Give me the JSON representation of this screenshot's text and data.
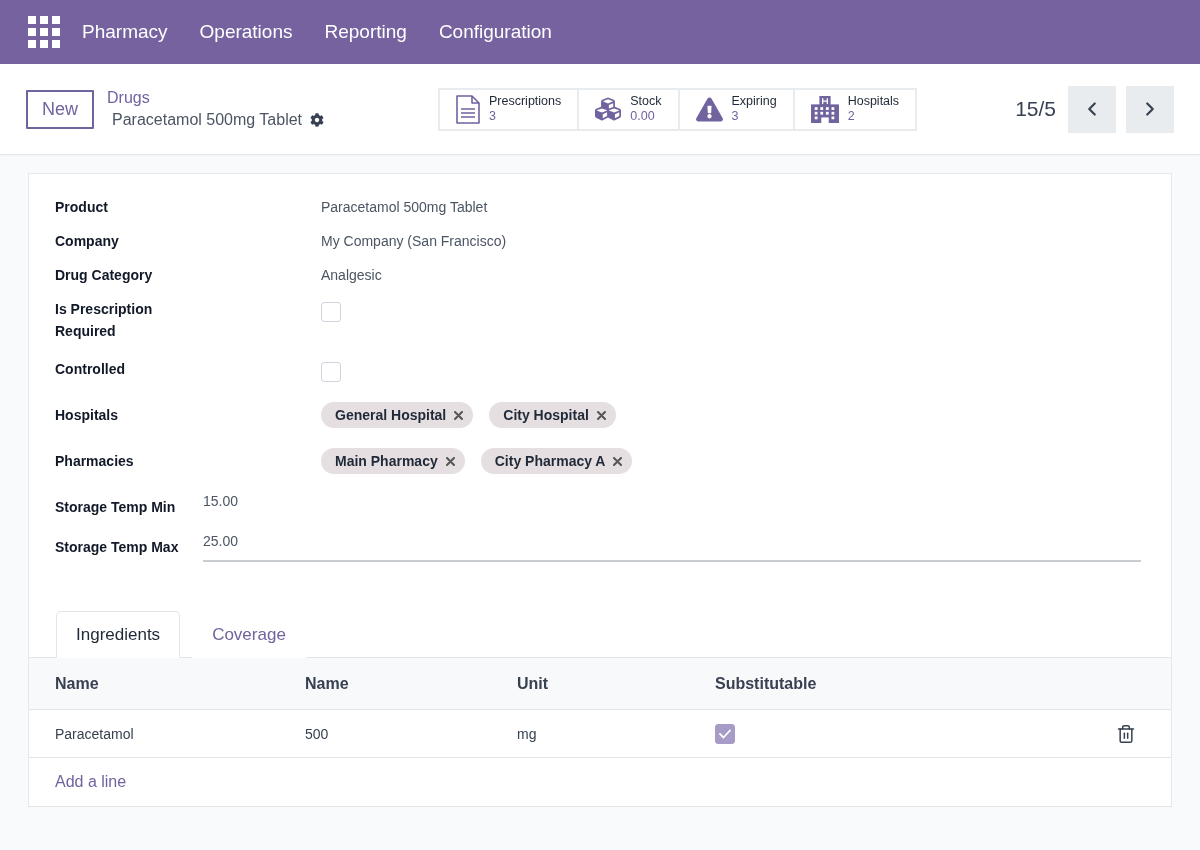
{
  "navbar": {
    "menu": [
      {
        "label": "Pharmacy"
      },
      {
        "label": "Operations"
      },
      {
        "label": "Reporting"
      },
      {
        "label": "Configuration"
      }
    ]
  },
  "control_panel": {
    "new_button": "New",
    "breadcrumb": {
      "parent": "Drugs",
      "current": "Paracetamol 500mg Tablet"
    },
    "smart_buttons": [
      {
        "kind": "document",
        "label": "Prescriptions",
        "value": "3"
      },
      {
        "kind": "cubes",
        "label": "Stock",
        "value": "0.00"
      },
      {
        "kind": "warning",
        "label": "Expiring",
        "value": "3"
      },
      {
        "kind": "building",
        "label": "Hospitals",
        "value": "2"
      }
    ],
    "pager": "15/5"
  },
  "form": {
    "fields": [
      {
        "kind": "text",
        "label": "Product",
        "value": "Paracetamol 500mg Tablet"
      },
      {
        "kind": "text",
        "label": "Company",
        "value": "My Company (San Francisco)"
      },
      {
        "kind": "text",
        "label": "Drug Category",
        "value": "Analgesic"
      },
      {
        "kind": "checkbox",
        "label": "Is Prescription Required",
        "checked": false
      },
      {
        "kind": "checkbox",
        "label": "Controlled",
        "checked": false
      },
      {
        "kind": "tags",
        "label": "Hospitals",
        "tags": [
          "General Hospital",
          "City Hospital"
        ]
      },
      {
        "kind": "tags",
        "label": "Pharmacies",
        "tags": [
          "Main Pharmacy",
          "City Pharmacy A"
        ]
      }
    ],
    "storage_fields": [
      {
        "label": "Storage Temp Min",
        "value": "15.00",
        "focused": false
      },
      {
        "label": "Storage Temp Max",
        "value": "25.00",
        "focused": true
      }
    ]
  },
  "tabs": [
    {
      "label": "Ingredients",
      "selected": true
    },
    {
      "label": "Coverage",
      "selected": false
    }
  ],
  "table": {
    "columns": [
      "Name",
      "Name",
      "Unit",
      "Substitutable"
    ],
    "rows": [
      {
        "cells": [
          "Paracetamol",
          "500",
          "mg"
        ],
        "substitutable": true
      }
    ],
    "add_line": "Add a line"
  }
}
